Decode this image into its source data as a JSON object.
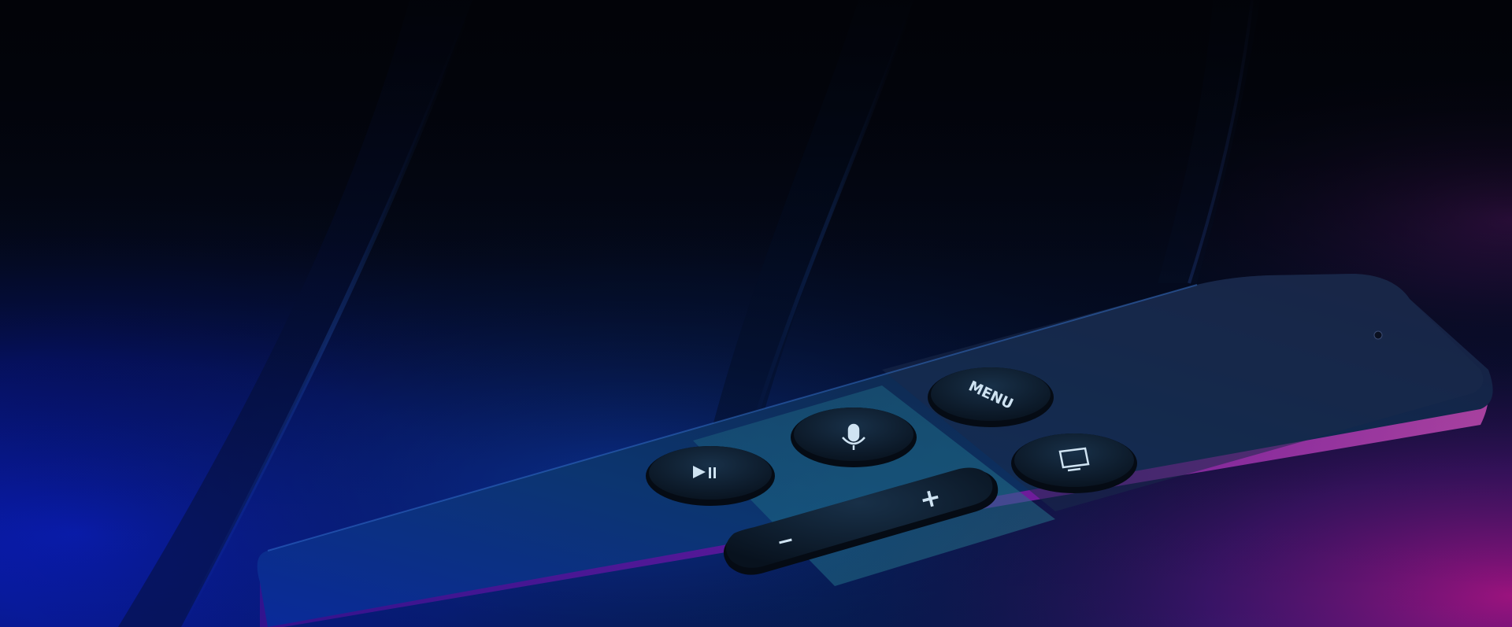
{
  "image": {
    "subject": "remote-control",
    "button_labels": {
      "menu": "MENU",
      "volume_up": "+",
      "volume_down": "−"
    },
    "colors": {
      "background_dark": "#03050d",
      "deep_blue": "#0a1ea8",
      "magenta_glow": "#b8128a",
      "remote_top": "#0f2a52",
      "button_fill": "#0b1b2c",
      "icon_color": "#cfe3f2"
    }
  }
}
